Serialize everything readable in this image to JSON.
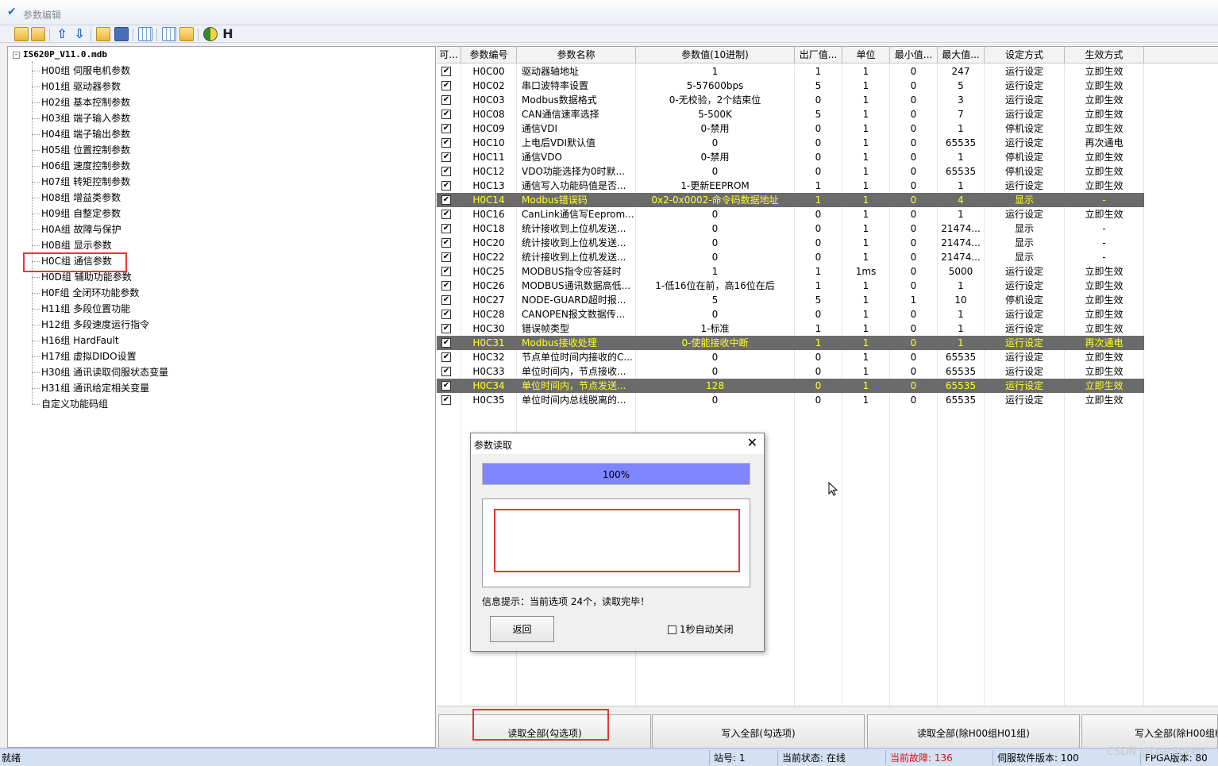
{
  "window": {
    "title": "参数编辑"
  },
  "toolbar": {
    "h_label": "H"
  },
  "tree": {
    "root": "IS620P_V11.0.mdb",
    "expander": "-",
    "items": [
      "H00组 伺服电机参数",
      "H01组 驱动器参数",
      "H02组 基本控制参数",
      "H03组 端子输入参数",
      "H04组 端子输出参数",
      "H05组 位置控制参数",
      "H06组 速度控制参数",
      "H07组 转矩控制参数",
      "H08组 增益类参数",
      "H09组 自整定参数",
      "H0A组 故障与保护",
      "H0B组 显示参数",
      "H0C组 通信参数",
      "H0D组 辅助功能参数",
      "H0F组 全闭环功能参数",
      "H11组 多段位置功能",
      "H12组 多段速度运行指令",
      "H16组 HardFault",
      "H17组 虚拟DIDO设置",
      "H30组 通讯读取伺服状态变量",
      "H31组 通讯给定相关变量",
      "自定义功能码组"
    ]
  },
  "grid": {
    "headers": [
      "可...",
      "参数编号",
      "参数名称",
      "参数值(10进制)",
      "出厂值...",
      "单位",
      "最小值...",
      "最大值...",
      "设定方式",
      "生效方式"
    ],
    "rows": [
      {
        "chk": "✔",
        "code": "H0C00",
        "name": "驱动器轴地址",
        "value": "1",
        "factory": "1",
        "unit": "1",
        "min": "0",
        "max": "247",
        "set": "运行设定",
        "effect": "立即生效",
        "sel": false
      },
      {
        "chk": "✔",
        "code": "H0C02",
        "name": "串口波特率设置",
        "value": "5-57600bps",
        "factory": "5",
        "unit": "1",
        "min": "0",
        "max": "5",
        "set": "运行设定",
        "effect": "立即生效",
        "sel": false
      },
      {
        "chk": "✔",
        "code": "H0C03",
        "name": "Modbus数据格式",
        "value": "0-无校验，2个结束位",
        "factory": "0",
        "unit": "1",
        "min": "0",
        "max": "3",
        "set": "运行设定",
        "effect": "立即生效",
        "sel": false
      },
      {
        "chk": "✔",
        "code": "H0C08",
        "name": "CAN通信速率选择",
        "value": "5-500K",
        "factory": "5",
        "unit": "1",
        "min": "0",
        "max": "7",
        "set": "运行设定",
        "effect": "立即生效",
        "sel": false
      },
      {
        "chk": "✔",
        "code": "H0C09",
        "name": "通信VDI",
        "value": "0-禁用",
        "factory": "0",
        "unit": "1",
        "min": "0",
        "max": "1",
        "set": "停机设定",
        "effect": "立即生效",
        "sel": false
      },
      {
        "chk": "✔",
        "code": "H0C10",
        "name": "上电后VDI默认值",
        "value": "0",
        "factory": "0",
        "unit": "1",
        "min": "0",
        "max": "65535",
        "set": "运行设定",
        "effect": "再次通电",
        "sel": false
      },
      {
        "chk": "✔",
        "code": "H0C11",
        "name": "通信VDO",
        "value": "0-禁用",
        "factory": "0",
        "unit": "1",
        "min": "0",
        "max": "1",
        "set": "停机设定",
        "effect": "立即生效",
        "sel": false
      },
      {
        "chk": "✔",
        "code": "H0C12",
        "name": "VDO功能选择为0时默...",
        "value": "0",
        "factory": "0",
        "unit": "1",
        "min": "0",
        "max": "65535",
        "set": "停机设定",
        "effect": "立即生效",
        "sel": false
      },
      {
        "chk": "✔",
        "code": "H0C13",
        "name": "通信写入功能码值是否...",
        "value": "1-更新EEPROM",
        "factory": "1",
        "unit": "1",
        "min": "0",
        "max": "1",
        "set": "运行设定",
        "effect": "立即生效",
        "sel": false
      },
      {
        "chk": "✔",
        "code": "H0C14",
        "name": "Modbus错误码",
        "value": "0x2-0x0002-命令码数据地址",
        "factory": "1",
        "unit": "1",
        "min": "0",
        "max": "4",
        "set": "显示",
        "effect": "-",
        "sel": true
      },
      {
        "chk": "✔",
        "code": "H0C16",
        "name": "CanLink通信写Eeprom...",
        "value": "0",
        "factory": "0",
        "unit": "1",
        "min": "0",
        "max": "1",
        "set": "运行设定",
        "effect": "立即生效",
        "sel": false
      },
      {
        "chk": "✔",
        "code": "H0C18",
        "name": "统计接收到上位机发送...",
        "value": "0",
        "factory": "0",
        "unit": "1",
        "min": "0",
        "max": "21474...",
        "set": "显示",
        "effect": "-",
        "sel": false
      },
      {
        "chk": "✔",
        "code": "H0C20",
        "name": "统计接收到上位机发送...",
        "value": "0",
        "factory": "0",
        "unit": "1",
        "min": "0",
        "max": "21474...",
        "set": "显示",
        "effect": "-",
        "sel": false
      },
      {
        "chk": "✔",
        "code": "H0C22",
        "name": "统计接收到上位机发送...",
        "value": "0",
        "factory": "0",
        "unit": "1",
        "min": "0",
        "max": "21474...",
        "set": "显示",
        "effect": "-",
        "sel": false
      },
      {
        "chk": "✔",
        "code": "H0C25",
        "name": "MODBUS指令应答延时",
        "value": "1",
        "factory": "1",
        "unit": "1ms",
        "min": "0",
        "max": "5000",
        "set": "运行设定",
        "effect": "立即生效",
        "sel": false
      },
      {
        "chk": "✔",
        "code": "H0C26",
        "name": "MODBUS通讯数据高低...",
        "value": "1-低16位在前，高16位在后",
        "factory": "1",
        "unit": "1",
        "min": "0",
        "max": "1",
        "set": "运行设定",
        "effect": "立即生效",
        "sel": false
      },
      {
        "chk": "✔",
        "code": "H0C27",
        "name": "NODE-GUARD超时报...",
        "value": "5",
        "factory": "5",
        "unit": "1",
        "min": "1",
        "max": "10",
        "set": "停机设定",
        "effect": "立即生效",
        "sel": false
      },
      {
        "chk": "✔",
        "code": "H0C28",
        "name": "CANOPEN报文数据传...",
        "value": "0",
        "factory": "0",
        "unit": "1",
        "min": "0",
        "max": "1",
        "set": "运行设定",
        "effect": "立即生效",
        "sel": false
      },
      {
        "chk": "✔",
        "code": "H0C30",
        "name": "错误帧类型",
        "value": "1-标准",
        "factory": "1",
        "unit": "1",
        "min": "0",
        "max": "1",
        "set": "运行设定",
        "effect": "立即生效",
        "sel": false
      },
      {
        "chk": "✔",
        "code": "H0C31",
        "name": "Modbus接收处理",
        "value": "0-使能接收中断",
        "factory": "1",
        "unit": "1",
        "min": "0",
        "max": "1",
        "set": "运行设定",
        "effect": "再次通电",
        "sel": true
      },
      {
        "chk": "✔",
        "code": "H0C32",
        "name": "节点单位时间内接收的C...",
        "value": "0",
        "factory": "0",
        "unit": "1",
        "min": "0",
        "max": "65535",
        "set": "运行设定",
        "effect": "立即生效",
        "sel": false
      },
      {
        "chk": "✔",
        "code": "H0C33",
        "name": "单位时间内，节点接收...",
        "value": "0",
        "factory": "0",
        "unit": "1",
        "min": "0",
        "max": "65535",
        "set": "运行设定",
        "effect": "立即生效",
        "sel": false
      },
      {
        "chk": "✔",
        "code": "H0C34",
        "name": "单位时间内，节点发送...",
        "value": "128",
        "factory": "0",
        "unit": "1",
        "min": "0",
        "max": "65535",
        "set": "运行设定",
        "effect": "立即生效",
        "sel": true
      },
      {
        "chk": "✔",
        "code": "H0C35",
        "name": "单位时间内总线脱离的...",
        "value": "0",
        "factory": "0",
        "unit": "1",
        "min": "0",
        "max": "65535",
        "set": "运行设定",
        "effect": "立即生效",
        "sel": false
      }
    ]
  },
  "buttons": {
    "read_all_checked": "读取全部(勾选项)",
    "write_all_checked": "写入全部(勾选项)",
    "read_all_except": "读取全部(除H00组H01组)",
    "write_all_except": "写入全部(除H00组H0"
  },
  "dialog": {
    "title": "参数读取",
    "close": "✕",
    "progress_text": "100%",
    "progress_fraction": 1.0,
    "info": "信息提示：当前选项 24个，读取完毕！",
    "back": "返回",
    "auto_close": "1秒自动关闭",
    "auto_close_checked": false
  },
  "status": {
    "ready": "就绪",
    "station": "站号: 1",
    "state": "当前状态: 在线",
    "fault": "当前故障: 136",
    "fault_color": "#e01010",
    "sw_version": "伺服软件版本: 100",
    "fpga_version": "FPGA版本: 80"
  },
  "watermark": "CSDN @LoatSpeed",
  "colors": {
    "selected_row_bg": "#6b6b6b",
    "selected_row_text": "#ffff2a",
    "progress_fill": "#7f86ff",
    "highlight": "#e53935"
  }
}
